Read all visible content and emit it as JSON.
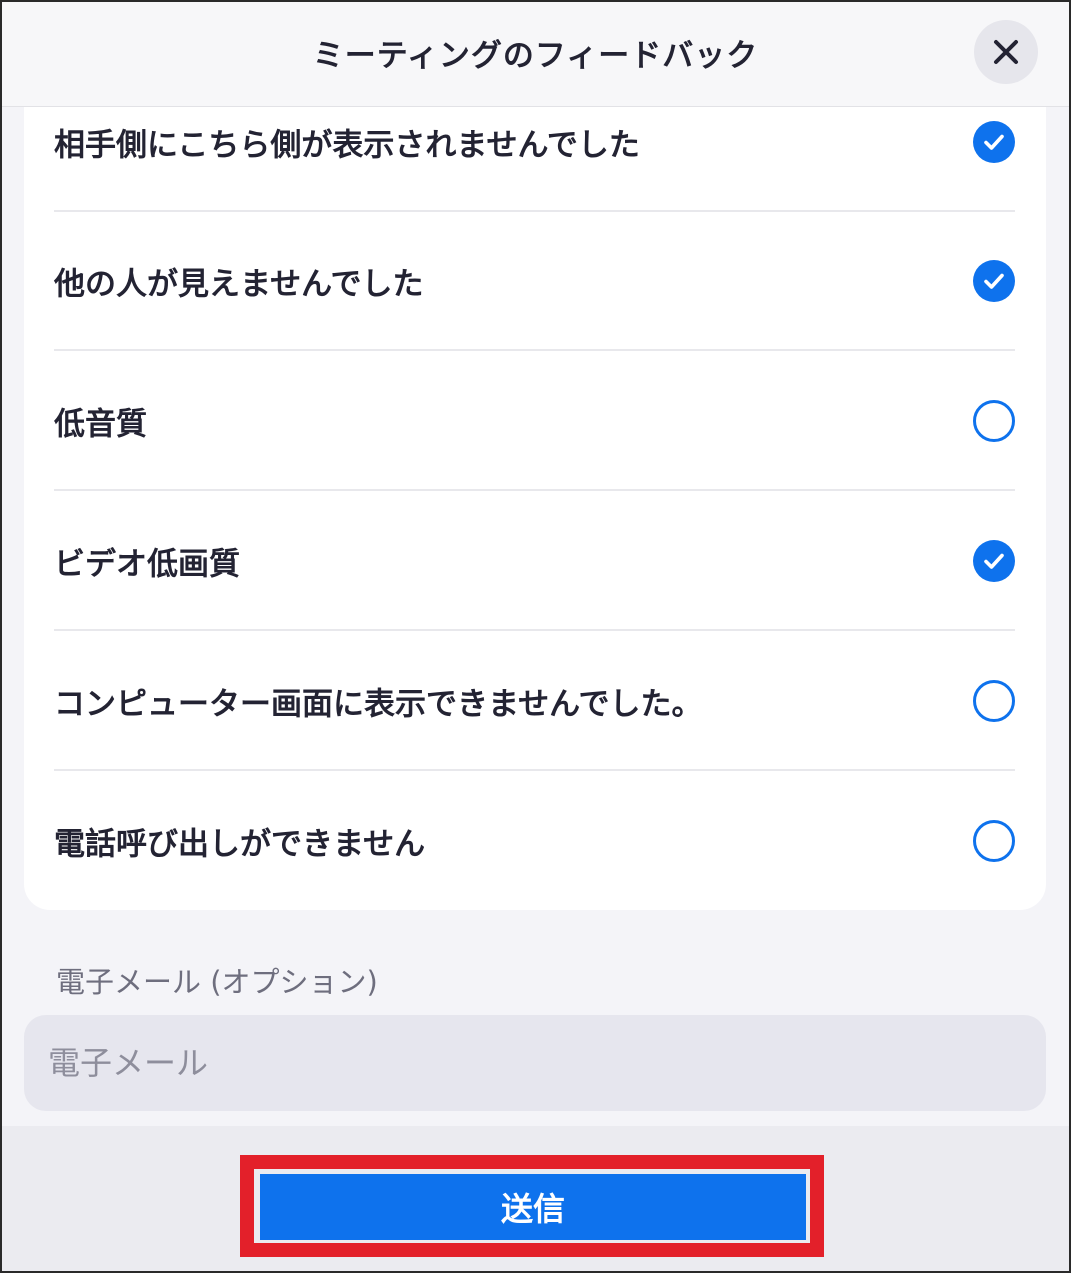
{
  "header": {
    "title": "ミーティングのフィードバック",
    "close_icon": "close-icon"
  },
  "options": [
    {
      "label": "相手側にこちら側が表示されませんでした",
      "checked": true
    },
    {
      "label": "他の人が見えませんでした",
      "checked": true
    },
    {
      "label": "低音質",
      "checked": false
    },
    {
      "label": "ビデオ低画質",
      "checked": true
    },
    {
      "label": "コンピューター画面に表示できませんでした。",
      "checked": false
    },
    {
      "label": "電話呼び出しができません",
      "checked": false
    }
  ],
  "email": {
    "label": "電子メール (オプション)",
    "placeholder": "電子メール",
    "value": ""
  },
  "footer": {
    "submit_label": "送信"
  },
  "colors": {
    "accent": "#0e72ed",
    "highlight": "#e3202a"
  }
}
